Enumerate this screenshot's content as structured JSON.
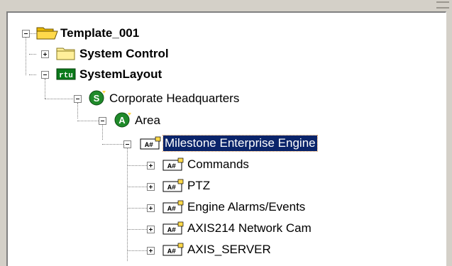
{
  "tree": {
    "root": {
      "label": "Template_001",
      "state": "expanded",
      "icon": "open-folder-icon"
    },
    "system_control": {
      "label": "System Control",
      "state": "collapsed",
      "icon": "folder-icon"
    },
    "system_layout": {
      "label": "SystemLayout",
      "state": "expanded",
      "icon": "rtu-icon",
      "icon_text": "rtu"
    },
    "corporate_hq": {
      "label": "Corporate Headquarters",
      "state": "expanded",
      "icon": "site-icon",
      "icon_text": "S"
    },
    "area": {
      "label": "Area",
      "state": "expanded",
      "icon": "area-icon",
      "icon_text": "A"
    },
    "milestone": {
      "label": "Milestone Enterprise Engine",
      "state": "expanded",
      "selected": true,
      "icon": "device-icon",
      "icon_text": "A#"
    },
    "children": [
      {
        "label": "Commands",
        "state": "collapsed",
        "icon": "device-icon",
        "icon_text": "A#"
      },
      {
        "label": "PTZ",
        "state": "collapsed",
        "icon": "device-icon",
        "icon_text": "A#"
      },
      {
        "label": "Engine Alarms/Events",
        "state": "collapsed",
        "icon": "device-icon",
        "icon_text": "A#"
      },
      {
        "label": "AXIS214 Network Cam",
        "state": "collapsed",
        "icon": "device-icon",
        "icon_text": "A#"
      },
      {
        "label": "AXIS_SERVER",
        "state": "collapsed",
        "icon": "device-icon",
        "icon_text": "A#"
      }
    ]
  },
  "colors": {
    "selection_bg": "#0a246a",
    "folder_yellow": "#ffd94a",
    "site_green": "#1f8a2a",
    "rtu_green": "#0b7a1b"
  }
}
